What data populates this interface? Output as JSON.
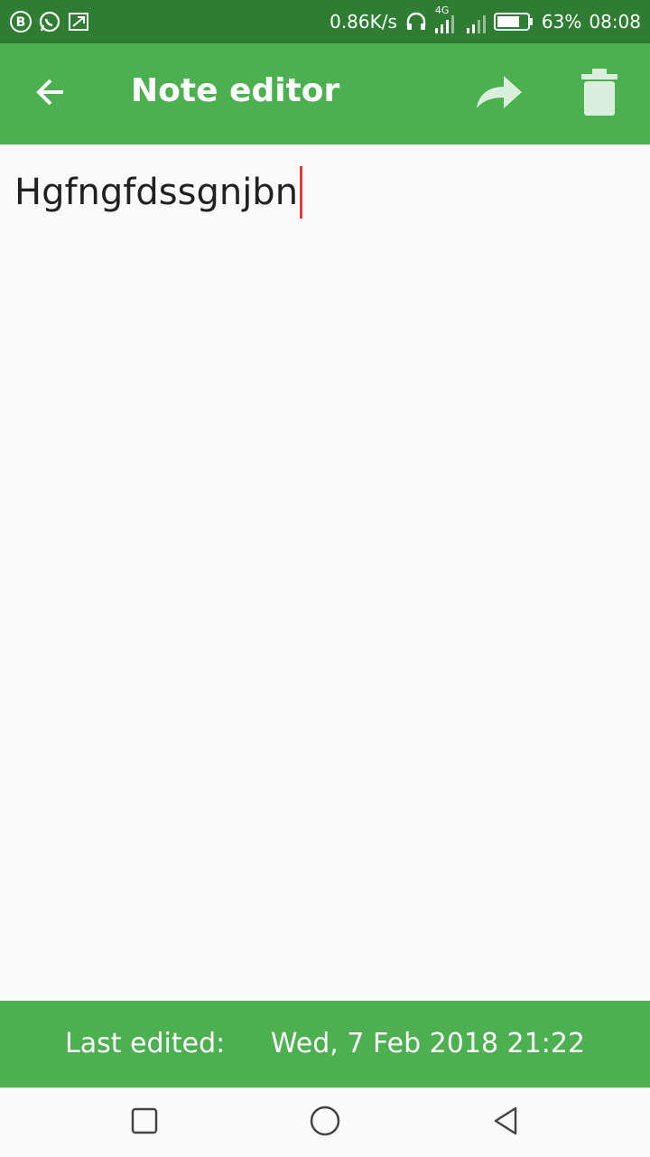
{
  "status_bar": {
    "network_speed": "0.86K/s",
    "network_type": "4G",
    "battery_percent": "63%",
    "time": "08:08",
    "icons": [
      "bubble-icon",
      "whatsapp-icon",
      "screenshot-icon",
      "headphones-icon",
      "signal-icon",
      "battery-icon"
    ]
  },
  "app_bar": {
    "title": "Note editor",
    "back_icon": "arrow-left-icon",
    "share_icon": "share-icon",
    "delete_icon": "trash-icon"
  },
  "editor": {
    "text": "Hgfngfdssgnjbn"
  },
  "footer": {
    "label": "Last edited:",
    "date": "Wed, 7 Feb 2018 21:22"
  },
  "nav_bar": {
    "icons": [
      "recent-apps-icon",
      "home-icon",
      "back-icon"
    ]
  },
  "colors": {
    "status_bar": "#2e7d32",
    "app_bar": "#4caf50",
    "cursor": "#e53935"
  }
}
